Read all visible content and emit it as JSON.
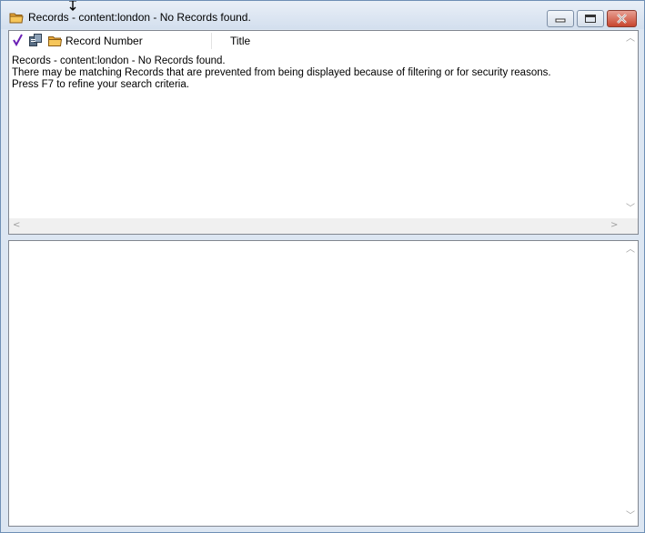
{
  "window": {
    "title": "Records - content:london - No Records found.",
    "icon": "folder-icon"
  },
  "controls": {
    "minimize_icon": "minimize-icon",
    "maximize_icon": "maximize-icon",
    "close_icon": "close-icon"
  },
  "list": {
    "columns": [
      {
        "icon": "checkmark-icon"
      },
      {
        "icon": "document-icon"
      },
      {
        "icon": "folder-icon",
        "label": "Record Number"
      },
      {
        "label": "Title"
      }
    ],
    "message_lines": [
      "Records - content:london - No Records found.",
      "There may be matching Records that are prevented from being displayed because of filtering or for security reasons.",
      "Press F7 to refine your search criteria."
    ]
  },
  "colors": {
    "accent_check": "#6a1fb5",
    "folder": "#e8a83a",
    "close_button": "#c7452e"
  }
}
